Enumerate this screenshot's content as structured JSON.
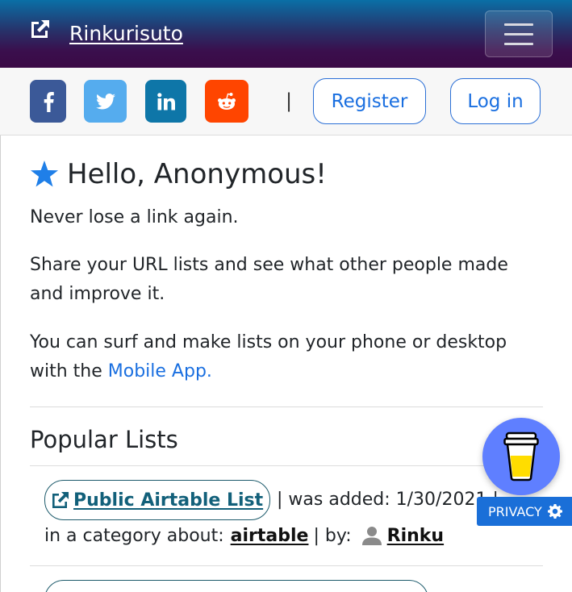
{
  "navbar": {
    "brand_text": "Rinkurisuto",
    "brand_icon": "external-link-icon",
    "toggler_icon": "hamburger-icon"
  },
  "social": {
    "items": [
      {
        "name": "facebook",
        "icon": "facebook-icon",
        "color": "#3b5998"
      },
      {
        "name": "twitter",
        "icon": "twitter-icon",
        "color": "#55acee"
      },
      {
        "name": "linkedin",
        "icon": "linkedin-icon",
        "color": "#0e76a8"
      },
      {
        "name": "reddit",
        "icon": "reddit-icon",
        "color": "#ff4500"
      }
    ],
    "separator": "|",
    "register_label": "Register",
    "login_label": "Log in"
  },
  "main": {
    "greeting": "Hello, Anonymous!",
    "tagline": "Never lose a link again.",
    "share_text": "Share your URL lists and see what other people made and improve it.",
    "surf_text": "You can surf and make lists on your phone or desktop with the ",
    "mobile_app_link": "Mobile App.",
    "section_title": "Popular Lists",
    "lists": [
      {
        "title": "Public Airtable List",
        "added_text": "| was added: 1/30/2021 |",
        "category_prefix": "in a category about:",
        "category": "airtable",
        "by_text": "| by:",
        "user": "Rinku"
      }
    ]
  },
  "widgets": {
    "coffee_icon": "coffee-cup-icon",
    "privacy_label": "PRIVACY",
    "privacy_icon": "gear-icon"
  },
  "colors": {
    "accent": "#1a6fe0",
    "coffee_bg": "#5f7fff",
    "privacy_bg": "#1a6fd8"
  }
}
